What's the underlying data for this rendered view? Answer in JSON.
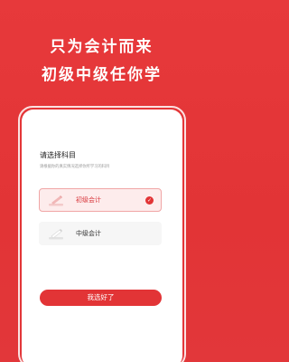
{
  "hero": {
    "line1": "只为会计而来",
    "line2": "初级中级任你学"
  },
  "card": {
    "title": "请选择科目",
    "subtitle": "请根据你的真实情况选择你所学习的科目"
  },
  "options": [
    {
      "label": "初级会计",
      "selected": true,
      "icon": "pencil-icon"
    },
    {
      "label": "中级会计",
      "selected": false,
      "icon": "pencil-icon"
    }
  ],
  "confirm_label": "我选好了",
  "colors": {
    "brand": "#e23436",
    "selected_bg": "#fdecec"
  }
}
